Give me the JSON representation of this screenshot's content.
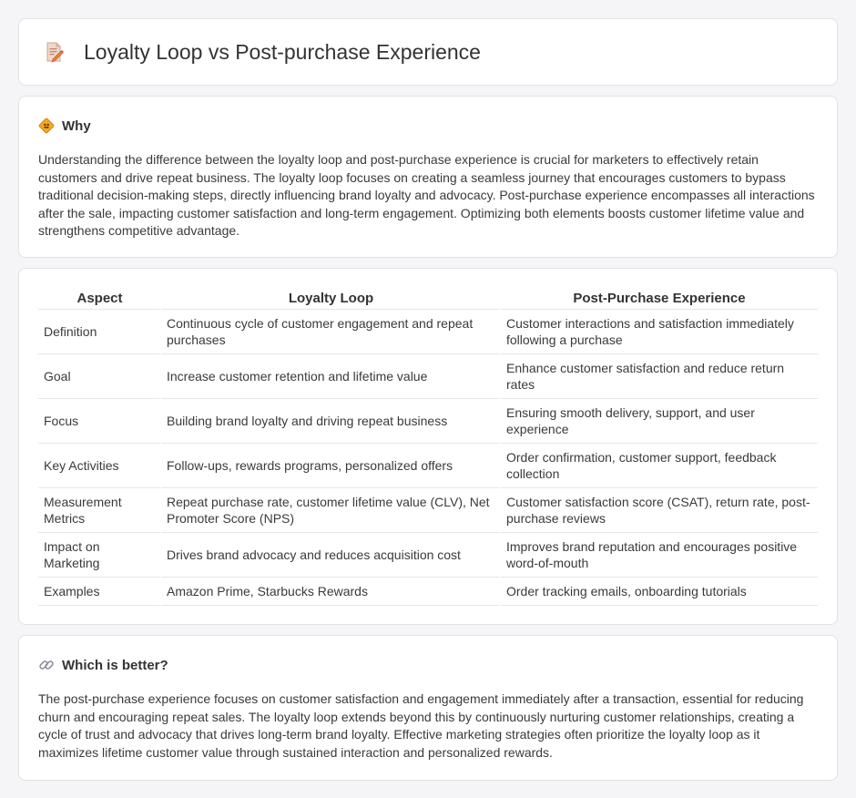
{
  "header": {
    "title": "Loyalty Loop vs Post-purchase Experience",
    "icon": "document-edit-icon"
  },
  "why": {
    "icon": "sign-icon",
    "title": "Why",
    "text": "Understanding the difference between the loyalty loop and post-purchase experience is crucial for marketers to effectively retain customers and drive repeat business. The loyalty loop focuses on creating a seamless journey that encourages customers to bypass traditional decision-making steps, directly influencing brand loyalty and advocacy. Post-purchase experience encompasses all interactions after the sale, impacting customer satisfaction and long-term engagement. Optimizing both elements boosts customer lifetime value and strengthens competitive advantage."
  },
  "table": {
    "headers": [
      "Aspect",
      "Loyalty Loop",
      "Post-Purchase Experience"
    ],
    "rows": [
      [
        "Definition",
        "Continuous cycle of customer engagement and repeat purchases",
        "Customer interactions and satisfaction immediately following a purchase"
      ],
      [
        "Goal",
        "Increase customer retention and lifetime value",
        "Enhance customer satisfaction and reduce return rates"
      ],
      [
        "Focus",
        "Building brand loyalty and driving repeat business",
        "Ensuring smooth delivery, support, and user experience"
      ],
      [
        "Key Activities",
        "Follow-ups, rewards programs, personalized offers",
        "Order confirmation, customer support, feedback collection"
      ],
      [
        "Measurement Metrics",
        "Repeat purchase rate, customer lifetime value (CLV), Net Promoter Score (NPS)",
        "Customer satisfaction score (CSAT), return rate, post-purchase reviews"
      ],
      [
        "Impact on Marketing",
        "Drives brand advocacy and reduces acquisition cost",
        "Improves brand reputation and encourages positive word-of-mouth"
      ],
      [
        "Examples",
        "Amazon Prime, Starbucks Rewards",
        "Order tracking emails, onboarding tutorials"
      ]
    ]
  },
  "better": {
    "icon": "link-icon",
    "title": "Which is better?",
    "text": "The post-purchase experience focuses on customer satisfaction and engagement immediately after a transaction, essential for reducing churn and encouraging repeat sales. The loyalty loop extends beyond this by continuously nurturing customer relationships, creating a cycle of trust and advocacy that drives long-term brand loyalty. Effective marketing strategies often prioritize the loyalty loop as it maximizes lifetime customer value through sustained interaction and personalized rewards."
  }
}
